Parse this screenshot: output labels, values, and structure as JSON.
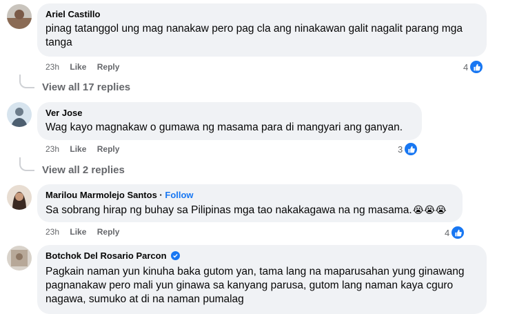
{
  "comments": [
    {
      "name": "Ariel Castillo",
      "text": "pinag tatanggol ung mag nanakaw pero pag cla ang ninakawan galit nagalit parang mga tanga",
      "time": "23h",
      "like": "Like",
      "reply": "Reply",
      "reactions": "4",
      "view_replies": "View all 17 replies"
    },
    {
      "name": "Ver Jose",
      "text": "Wag kayo magnakaw o gumawa ng masama para di mangyari ang ganyan.",
      "time": "23h",
      "like": "Like",
      "reply": "Reply",
      "reactions": "3",
      "view_replies": "View all 2 replies"
    },
    {
      "name": "Marilou Marmolejo Santos",
      "separator": " · ",
      "follow": "Follow",
      "text": "Sa sobrang hirap ng buhay sa Pilipinas mga tao nakakagawa na ng masama.",
      "emojis": "😭😭😭",
      "time": "23h",
      "like": "Like",
      "reply": "Reply",
      "reactions": "4"
    },
    {
      "name": "Botchok Del Rosario Parcon",
      "verified": true,
      "text": "Pagkain naman yun kinuha baka gutom yan, tama lang na maparusahan yung ginawang pagnanakaw pero mali yun ginawa sa kanyang parusa, gutom lang naman kaya cguro nagawa, sumuko at di na naman pumalag"
    }
  ],
  "colors": {
    "bubble": "#f0f2f5",
    "meta": "#65676b",
    "accent": "#1877f2"
  }
}
